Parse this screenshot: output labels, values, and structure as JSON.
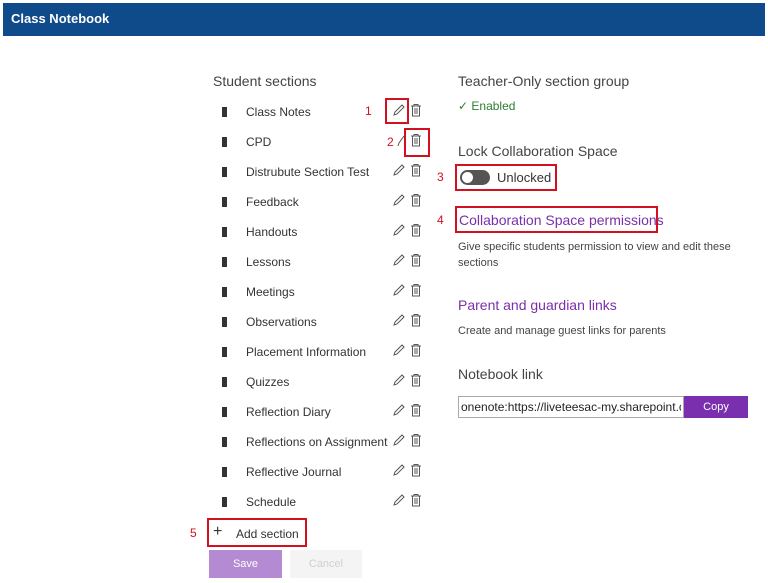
{
  "app": {
    "title": "Class Notebook"
  },
  "student_sections": {
    "title": "Student sections",
    "items": [
      "Class Notes",
      "CPD",
      "Distrubute Section Test",
      "Feedback",
      "Handouts",
      "Lessons",
      "Meetings",
      "Observations",
      "Placement Information",
      "Quizzes",
      "Reflection Diary",
      "Reflections on Assignment",
      "Reflective Journal",
      "Schedule"
    ],
    "add_label": "Add section",
    "save_label": "Save",
    "cancel_label": "Cancel"
  },
  "teacher_only": {
    "title": "Teacher-Only section group",
    "status": "Enabled"
  },
  "lock": {
    "title": "Lock Collaboration Space",
    "toggle_label": "Unlocked"
  },
  "collab_permissions": {
    "link": "Collaboration Space permissions",
    "desc_line1": "Give specific students permission to view and edit these",
    "desc_line2": "sections"
  },
  "parent_links": {
    "link": "Parent and guardian links",
    "desc": "Create and manage guest links for parents"
  },
  "notebook_link": {
    "title": "Notebook link",
    "value": "onenote:https://liveteesac-my.sharepoint.com/",
    "copy_label": "Copy"
  },
  "annotations": {
    "n1": "1",
    "n2": "2",
    "n3": "3",
    "n4": "4",
    "n5": "5"
  },
  "colors": {
    "header": "#0f4a8a",
    "accent": "#7a2fae",
    "annotation": "#d31020",
    "enabled": "#2e7d32"
  }
}
